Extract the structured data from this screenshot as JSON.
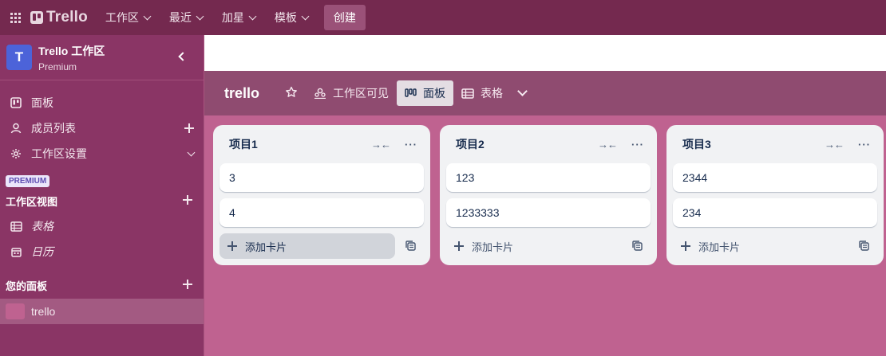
{
  "topnav": {
    "logo": "Trello",
    "menus": [
      "工作区",
      "最近",
      "加星",
      "模板"
    ],
    "create": "创建"
  },
  "sidebar": {
    "workspace_initial": "T",
    "workspace_name": "Trello 工作区",
    "workspace_plan": "Premium",
    "items": [
      {
        "label": "面板",
        "icon": "board-icon"
      },
      {
        "label": "成员列表",
        "icon": "member-icon"
      },
      {
        "label": "工作区设置",
        "icon": "gear-icon"
      }
    ],
    "premium_badge": "PREMIUM",
    "views_title": "工作区视图",
    "views": [
      {
        "label": "表格",
        "icon": "table-icon"
      },
      {
        "label": "日历",
        "icon": "calendar-icon"
      }
    ],
    "boards_title": "您的面板",
    "boards": [
      {
        "label": "trello",
        "color": "#bf6290"
      }
    ]
  },
  "board": {
    "title": "trello",
    "visibility": "工作区可见",
    "view_board": "面板",
    "view_table": "表格"
  },
  "lists": [
    {
      "title": "项目1",
      "cards": [
        "3",
        "4"
      ],
      "add_label": "添加卡片"
    },
    {
      "title": "项目2",
      "cards": [
        "123",
        "1233333"
      ],
      "add_label": "添加卡片"
    },
    {
      "title": "项目3",
      "cards": [
        "2344",
        "234"
      ],
      "add_label": "添加卡片"
    }
  ],
  "colors": {
    "topbar": "#74294f",
    "sidebar": "#8a3565",
    "board_bg": "#bf6290",
    "board_header": "#8f4b70",
    "accent_avatar": "#4c63d9"
  }
}
